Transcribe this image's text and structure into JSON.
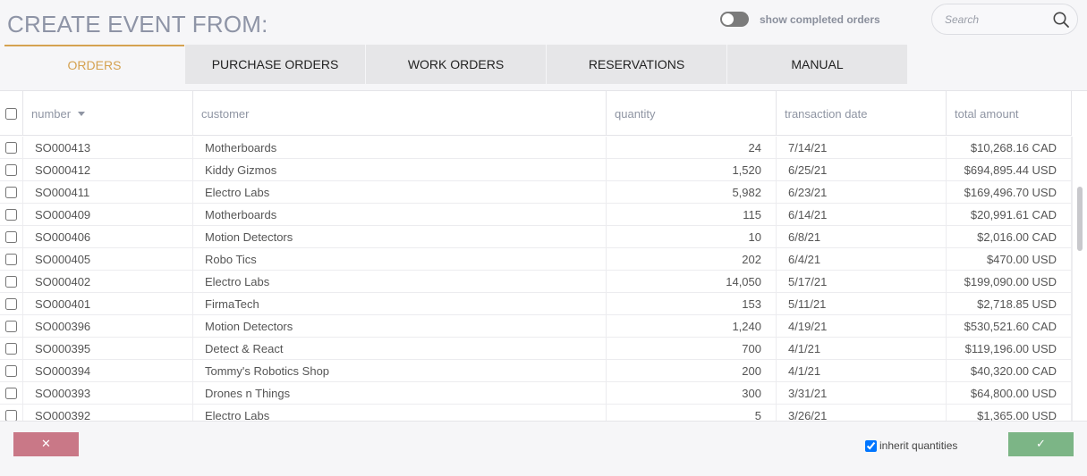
{
  "title": "CREATE EVENT FROM:",
  "toggle": {
    "label": "show completed orders",
    "on": false
  },
  "search": {
    "placeholder": "Search",
    "value": ""
  },
  "tabs": [
    {
      "label": "ORDERS",
      "active": true
    },
    {
      "label": "PURCHASE ORDERS"
    },
    {
      "label": "WORK ORDERS"
    },
    {
      "label": "RESERVATIONS"
    },
    {
      "label": "MANUAL"
    }
  ],
  "table": {
    "columns": [
      "number",
      "customer",
      "quantity",
      "transaction date",
      "total amount"
    ],
    "rows": [
      [
        "SO000413",
        "Motherboards",
        "24",
        "7/14/21",
        "$10,268.16 CAD"
      ],
      [
        "SO000412",
        "Kiddy Gizmos",
        "1,520",
        "6/25/21",
        "$694,895.44 USD"
      ],
      [
        "SO000411",
        "Electro Labs",
        "5,982",
        "6/23/21",
        "$169,496.70 USD"
      ],
      [
        "SO000409",
        "Motherboards",
        "115",
        "6/14/21",
        "$20,991.61 CAD"
      ],
      [
        "SO000406",
        "Motion Detectors",
        "10",
        "6/8/21",
        "$2,016.00 CAD"
      ],
      [
        "SO000405",
        "Robo Tics",
        "202",
        "6/4/21",
        "$470.00 USD"
      ],
      [
        "SO000402",
        "Electro Labs",
        "14,050",
        "5/17/21",
        "$199,090.00 USD"
      ],
      [
        "SO000401",
        "FirmaTech",
        "153",
        "5/11/21",
        "$2,718.85 USD"
      ],
      [
        "SO000396",
        "Motion Detectors",
        "1,240",
        "4/19/21",
        "$530,521.60 CAD"
      ],
      [
        "SO000395",
        "Detect & React",
        "700",
        "4/1/21",
        "$119,196.00 USD"
      ],
      [
        "SO000394",
        "Tommy's Robotics Shop",
        "200",
        "4/1/21",
        "$40,320.00 CAD"
      ],
      [
        "SO000393",
        "Drones n Things",
        "300",
        "3/31/21",
        "$64,800.00 USD"
      ],
      [
        "SO000392",
        "Electro Labs",
        "5",
        "3/26/21",
        "$1,365.00 USD"
      ]
    ]
  },
  "footer": {
    "cancel_icon": "✕",
    "confirm_icon": "✓",
    "inherit_label": "inherit quantities",
    "inherit_checked": true
  },
  "colors": {
    "accent": "#d5a251",
    "cancel": "#c97887",
    "confirm": "#7cb586"
  }
}
